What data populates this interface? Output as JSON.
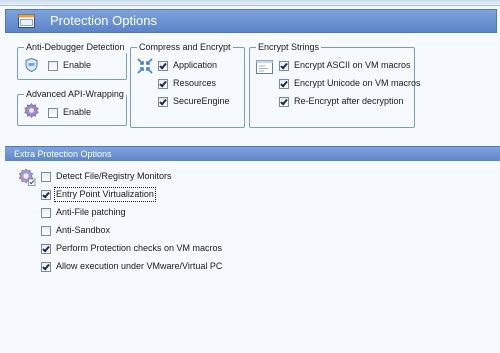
{
  "header": {
    "title": "Protection Options"
  },
  "anti_debugger": {
    "title": "Anti-Debugger Detection",
    "enable": {
      "label": "Enable",
      "checked": false
    }
  },
  "api_wrapping": {
    "title": "Advanced API-Wrapping",
    "enable": {
      "label": "Enable",
      "checked": false
    }
  },
  "compress_encrypt": {
    "title": "Compress and Encrypt",
    "items": [
      {
        "label": "Application",
        "checked": true
      },
      {
        "label": "Resources",
        "checked": true
      },
      {
        "label": "SecureEngine",
        "checked": true
      }
    ]
  },
  "encrypt_strings": {
    "title": "Encrypt Strings",
    "items": [
      {
        "label": "Encrypt ASCII on VM macros",
        "checked": true
      },
      {
        "label": "Encrypt Unicode on VM macros",
        "checked": true
      },
      {
        "label": "Re-Encrypt after decryption",
        "checked": true
      }
    ]
  },
  "extra": {
    "title": "Extra Protection Options",
    "items": [
      {
        "label": "Detect File/Registry Monitors",
        "checked": false
      },
      {
        "label": "Entry Point Virtualization",
        "checked": true
      },
      {
        "label": "Anti-File patching",
        "checked": false
      },
      {
        "label": "Anti-Sandbox",
        "checked": false
      },
      {
        "label": "Perform Protection checks on VM macros",
        "checked": true
      },
      {
        "label": "Allow execution under VMware/Virtual PC",
        "checked": true
      }
    ]
  }
}
